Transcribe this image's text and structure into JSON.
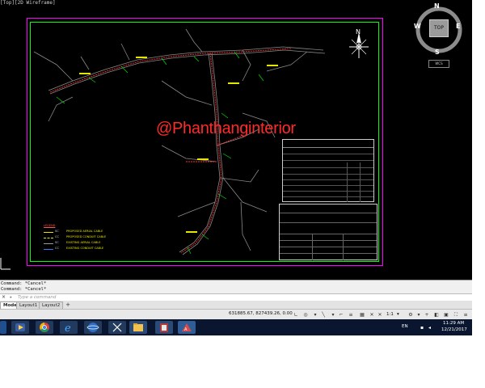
{
  "viewport": {
    "label": "[Top][2D Wireframe]",
    "watermark": "@Phanthanginterior",
    "north_label": "N"
  },
  "viewcube": {
    "north": "N",
    "south": "S",
    "east": "E",
    "west": "W",
    "face": "TOP",
    "wcs": "WCS"
  },
  "drawing": {
    "legend": {
      "title": "LEGEND",
      "items": [
        {
          "symbol": "SC",
          "text": "PROPOSED AERIAL CABLE",
          "color": "#e6e600"
        },
        {
          "symbol": "CC",
          "text": "PROPOSED CONDUIT CABLE",
          "color": "#e6e600"
        },
        {
          "symbol": "SC",
          "text": "EXISTING AERIAL CABLE",
          "color": "#9a9a9a"
        },
        {
          "symbol": "CC",
          "text": "EXISTING CONDUIT CABLE",
          "color": "#3a7bff"
        }
      ]
    }
  },
  "command": {
    "history": [
      "Command: *Cancel*",
      "Command: *Cancel*"
    ],
    "placeholder": "Type a command",
    "close_icon": "close-icon",
    "prompt_icon": "command-prompt-icon"
  },
  "layout_tabs": [
    {
      "label": "Model",
      "active": true
    },
    {
      "label": "Layout1",
      "active": false
    },
    {
      "label": "Layout2",
      "active": false
    }
  ],
  "status_bar": {
    "coordinates": "631885.67, 827439.26, 0.00",
    "scale": "1:1",
    "annotation_scale": "1:1"
  },
  "taskbar": {
    "apps": [
      "start-icon",
      "media-player-icon",
      "chrome-icon",
      "ie-icon",
      "network-icon",
      "snipping-icon",
      "file-explorer-icon",
      "archive-icon",
      "autocad-icon"
    ],
    "language": "EN",
    "time": "11:29 AM",
    "date": "12/21/2017"
  }
}
